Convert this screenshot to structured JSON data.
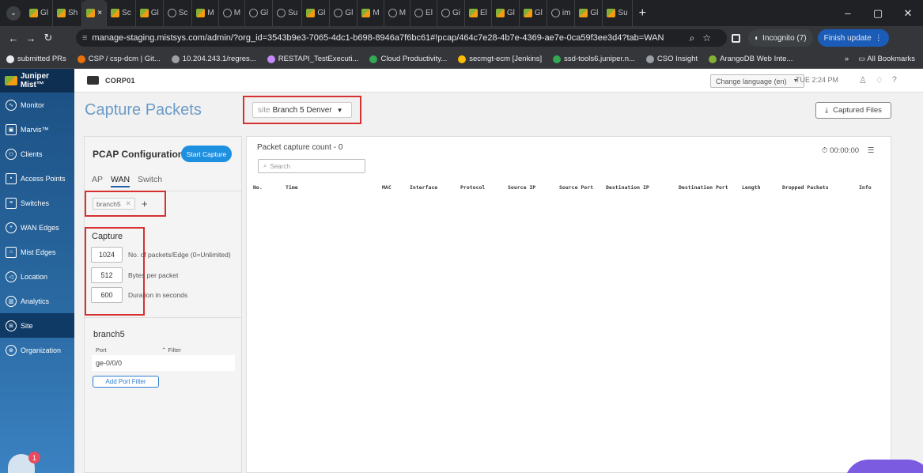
{
  "browser": {
    "tabs": [
      {
        "label": "Gl",
        "fav": "jm"
      },
      {
        "label": "Sh",
        "fav": "jm"
      },
      {
        "label": "×",
        "fav": "jm",
        "active": true
      },
      {
        "label": "Sc",
        "fav": "jm"
      },
      {
        "label": "Gl",
        "fav": "jm"
      },
      {
        "label": "Sc",
        "fav": "ci"
      },
      {
        "label": "M",
        "fav": "jm"
      },
      {
        "label": "M",
        "fav": "ci"
      },
      {
        "label": "Gl",
        "fav": "ci"
      },
      {
        "label": "Su",
        "fav": "ci"
      },
      {
        "label": "Gl",
        "fav": "jm"
      },
      {
        "label": "Gl",
        "fav": "ci"
      },
      {
        "label": "M",
        "fav": "jm"
      },
      {
        "label": "M",
        "fav": "ci"
      },
      {
        "label": "El",
        "fav": "ci"
      },
      {
        "label": "Gi",
        "fav": "ci"
      },
      {
        "label": "El",
        "fav": "jm"
      },
      {
        "label": "Gl",
        "fav": "jm"
      },
      {
        "label": "Gl",
        "fav": "jm"
      },
      {
        "label": "im",
        "fav": "ci"
      },
      {
        "label": "Gl",
        "fav": "jm"
      },
      {
        "label": "Su",
        "fav": "jm"
      }
    ],
    "url": "manage-staging.mistsys.com/admin/?org_id=3543b9e3-7065-4dc1-b698-8946a7f6bc61#!pcap/464c7e28-4b7e-4369-ae7e-0ca59f3ee3d4?tab=WAN",
    "incognito_label": "Incognito (7)",
    "finish_update_label": "Finish update",
    "bookmarks": [
      {
        "label": "submitted PRs",
        "color": "#e8eaed"
      },
      {
        "label": "CSP / csp-dcm | Git...",
        "color": "#e8710a"
      },
      {
        "label": "10.204.243.1/regres...",
        "color": "#9aa0a6"
      },
      {
        "label": "RESTAPI_TestExecuti...",
        "color": "#c58af9"
      },
      {
        "label": "Cloud Productivity...",
        "color": "#34a853"
      },
      {
        "label": "secmgt-ecm [Jenkins]",
        "color": "#fbbc04"
      },
      {
        "label": "ssd-tools6.juniper.n...",
        "color": "#34a853"
      },
      {
        "label": "CSO Insight",
        "color": "#9aa0a6"
      },
      {
        "label": "ArangoDB Web Inte...",
        "color": "#84b135"
      }
    ],
    "all_bookmarks_label": "All Bookmarks"
  },
  "sidebar": {
    "brand": "Juniper Mist™",
    "items": [
      {
        "label": "Monitor",
        "icon": "monitor-icon"
      },
      {
        "label": "Marvis™",
        "icon": "marvis-icon"
      },
      {
        "label": "Clients",
        "icon": "clients-icon"
      },
      {
        "label": "Access Points",
        "icon": "access-points-icon"
      },
      {
        "label": "Switches",
        "icon": "switches-icon"
      },
      {
        "label": "WAN Edges",
        "icon": "wan-edges-icon"
      },
      {
        "label": "Mist Edges",
        "icon": "mist-edges-icon"
      },
      {
        "label": "Location",
        "icon": "location-icon"
      },
      {
        "label": "Analytics",
        "icon": "analytics-icon"
      },
      {
        "label": "Site",
        "icon": "site-icon",
        "active": true
      },
      {
        "label": "Organization",
        "icon": "organization-icon"
      }
    ],
    "notification_count": "1"
  },
  "header": {
    "org_name": "CORP01",
    "language_label": "Change language (en)",
    "time": "TUE 2:24 PM"
  },
  "page": {
    "title": "Capture Packets",
    "site_prefix": "site",
    "site_value": "Branch 5 Denver",
    "captured_files_label": "Captured Files"
  },
  "pcap": {
    "title": "PCAP Configuration",
    "start_capture_label": "Start Capture",
    "tabs": [
      "AP",
      "WAN",
      "Switch"
    ],
    "chip": "branch5",
    "capture_title": "Capture",
    "fields": [
      {
        "value": "1024",
        "label": "No. of packets/Edge (0=Unlimited)"
      },
      {
        "value": "512",
        "label": "Bytes per packet"
      },
      {
        "value": "600",
        "label": "Duration in seconds"
      }
    ],
    "device_title": "branch5",
    "port_header": "Port",
    "filter_header": "Filter",
    "port_value": "ge-0/0/0",
    "add_port_filter_label": "Add Port Filter"
  },
  "results": {
    "count_label": "Packet capture count - 0",
    "search_placeholder": "Search",
    "timer": "00:00:00",
    "columns": [
      "No.",
      "Time",
      "MAC",
      "Interface",
      "Protocol",
      "Source IP",
      "Source Port",
      "Destination IP",
      "Destination Port",
      "Length",
      "Dropped Packets",
      "Info"
    ]
  },
  "colors": {
    "accent": "#1e90e0",
    "highlight_box": "#d63031",
    "title": "#6c9bc7"
  }
}
